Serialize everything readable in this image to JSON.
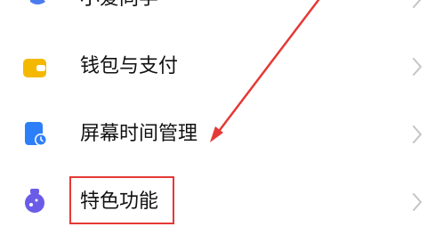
{
  "settings_list": {
    "items": [
      {
        "label": "小爱同学",
        "icon": "xiaoai-icon"
      },
      {
        "label": "钱包与支付",
        "icon": "wallet-icon"
      },
      {
        "label": "屏幕时间管理",
        "icon": "screen-time-icon"
      },
      {
        "label": "特色功能",
        "icon": "special-features-icon"
      }
    ]
  },
  "annotation": {
    "color": "#e53935",
    "highlighted_item": "特色功能"
  }
}
